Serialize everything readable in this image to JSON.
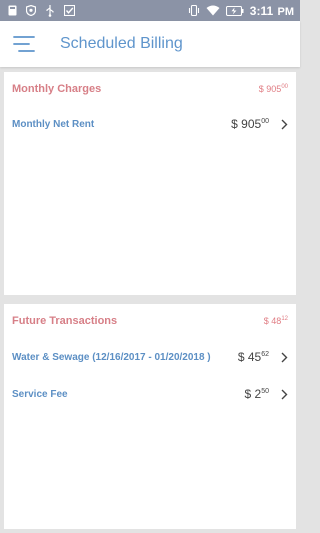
{
  "status_bar": {
    "time": "3:11",
    "time_suffix": "PM",
    "icons": [
      "notification-icon",
      "shield-icon",
      "usb-icon",
      "check-icon",
      "vibrate-icon",
      "wifi-icon",
      "battery-charging-icon"
    ]
  },
  "header": {
    "title": "Scheduled Billing",
    "menu_icon": "menu-icon"
  },
  "sections": {
    "monthly": {
      "title": "Monthly Charges",
      "total_symbol": "$",
      "total_main": "905",
      "total_cents": "00",
      "items": [
        {
          "label": "Monthly Net Rent",
          "symbol": "$",
          "amount_main": "905",
          "amount_cents": "00"
        }
      ]
    },
    "future": {
      "title": "Future Transactions",
      "total_symbol": "$",
      "total_main": "48",
      "total_cents": "12",
      "items": [
        {
          "label": "Water & Sewage (12/16/2017 - 01/20/2018 )",
          "symbol": "$",
          "amount_main": "45",
          "amount_cents": "62"
        },
        {
          "label": "Service Fee",
          "symbol": "$",
          "amount_main": "2",
          "amount_cents": "50"
        }
      ]
    }
  },
  "colors": {
    "status_bar_bg": "#8b93a6",
    "title_blue": "#5f95cc",
    "section_title_red": "#d77f87",
    "row_label_blue": "#5c8fc4",
    "page_bg": "#e3e3e3"
  }
}
